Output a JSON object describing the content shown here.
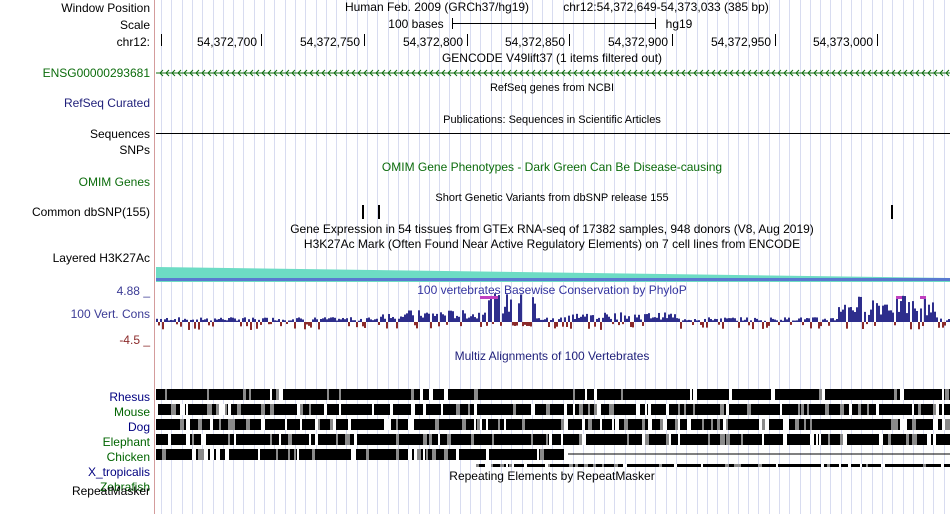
{
  "labels": {
    "window_position": "Window Position",
    "scale": "Scale",
    "chrom": "chr12:",
    "gene_id": "ENSG00000293681",
    "refseq": "RefSeq Curated",
    "sequences": "Sequences",
    "snps": "SNPs",
    "omim": "OMIM Genes",
    "dbsnp": "Common dbSNP(155)",
    "h3k27ac": "Layered H3K27Ac",
    "cons_max": "4.88 _",
    "cons": "100 Vert. Cons",
    "cons_min": "-4.5 _",
    "repeatmasker": "RepeatMasker"
  },
  "species": [
    {
      "name": "Rhesus",
      "color": "#000080"
    },
    {
      "name": "Mouse",
      "color": "#006400"
    },
    {
      "name": "Dog",
      "color": "#000080"
    },
    {
      "name": "Elephant",
      "color": "#006400"
    },
    {
      "name": "Chicken",
      "color": "#006400"
    },
    {
      "name": "X_tropicalis",
      "color": "#000080"
    },
    {
      "name": "Zebrafish",
      "color": "#006400"
    }
  ],
  "header": {
    "assembly": "Human Feb. 2009 (GRCh37/hg19)",
    "position": "chr12:54,372,649-54,373,033 (385 bp)",
    "scale_bases": "100 bases",
    "scale_db": "hg19"
  },
  "ruler": {
    "ticks": [
      "54,372,700",
      "54,372,750",
      "54,372,800",
      "54,372,850",
      "54,372,900",
      "54,372,950",
      "54,373,000"
    ]
  },
  "tracks": {
    "gencode": "GENCODE V49lift37 (1 items filtered out)",
    "refseq": "RefSeq genes from NCBI",
    "publications": "Publications: Sequences in Scientific Articles",
    "omim": "OMIM Gene Phenotypes - Dark Green Can Be Disease-causing",
    "dbsnp": "Short Genetic Variants from dbSNP release 155",
    "gtex": "Gene Expression in 54 tissues from GTEx RNA-seq of 17382 samples, 948 donors (V8, Aug 2019)",
    "h3k27ac": "H3K27Ac Mark (Often Found Near Active Regulatory Elements) on 7 cell lines from ENCODE",
    "phylop": "100 vertebrates Basewise Conservation by PhyloP",
    "multiz": "Multiz Alignments of 100 Vertebrates",
    "repeatmasker": "Repeating Elements by RepeatMasker"
  },
  "colors": {
    "gene": "#0c6c0c",
    "navy": "#1f1f7a",
    "cons_pos": "#2e2e8c",
    "cons_neg": "#8b2a2a",
    "h3k27ac": "#6ddcc4",
    "omim": "#0c6c0c",
    "phylop": "#3434a0",
    "cons_label": "#3c3c96",
    "peak": "#c040c0",
    "grid": "#d8dcf0"
  }
}
